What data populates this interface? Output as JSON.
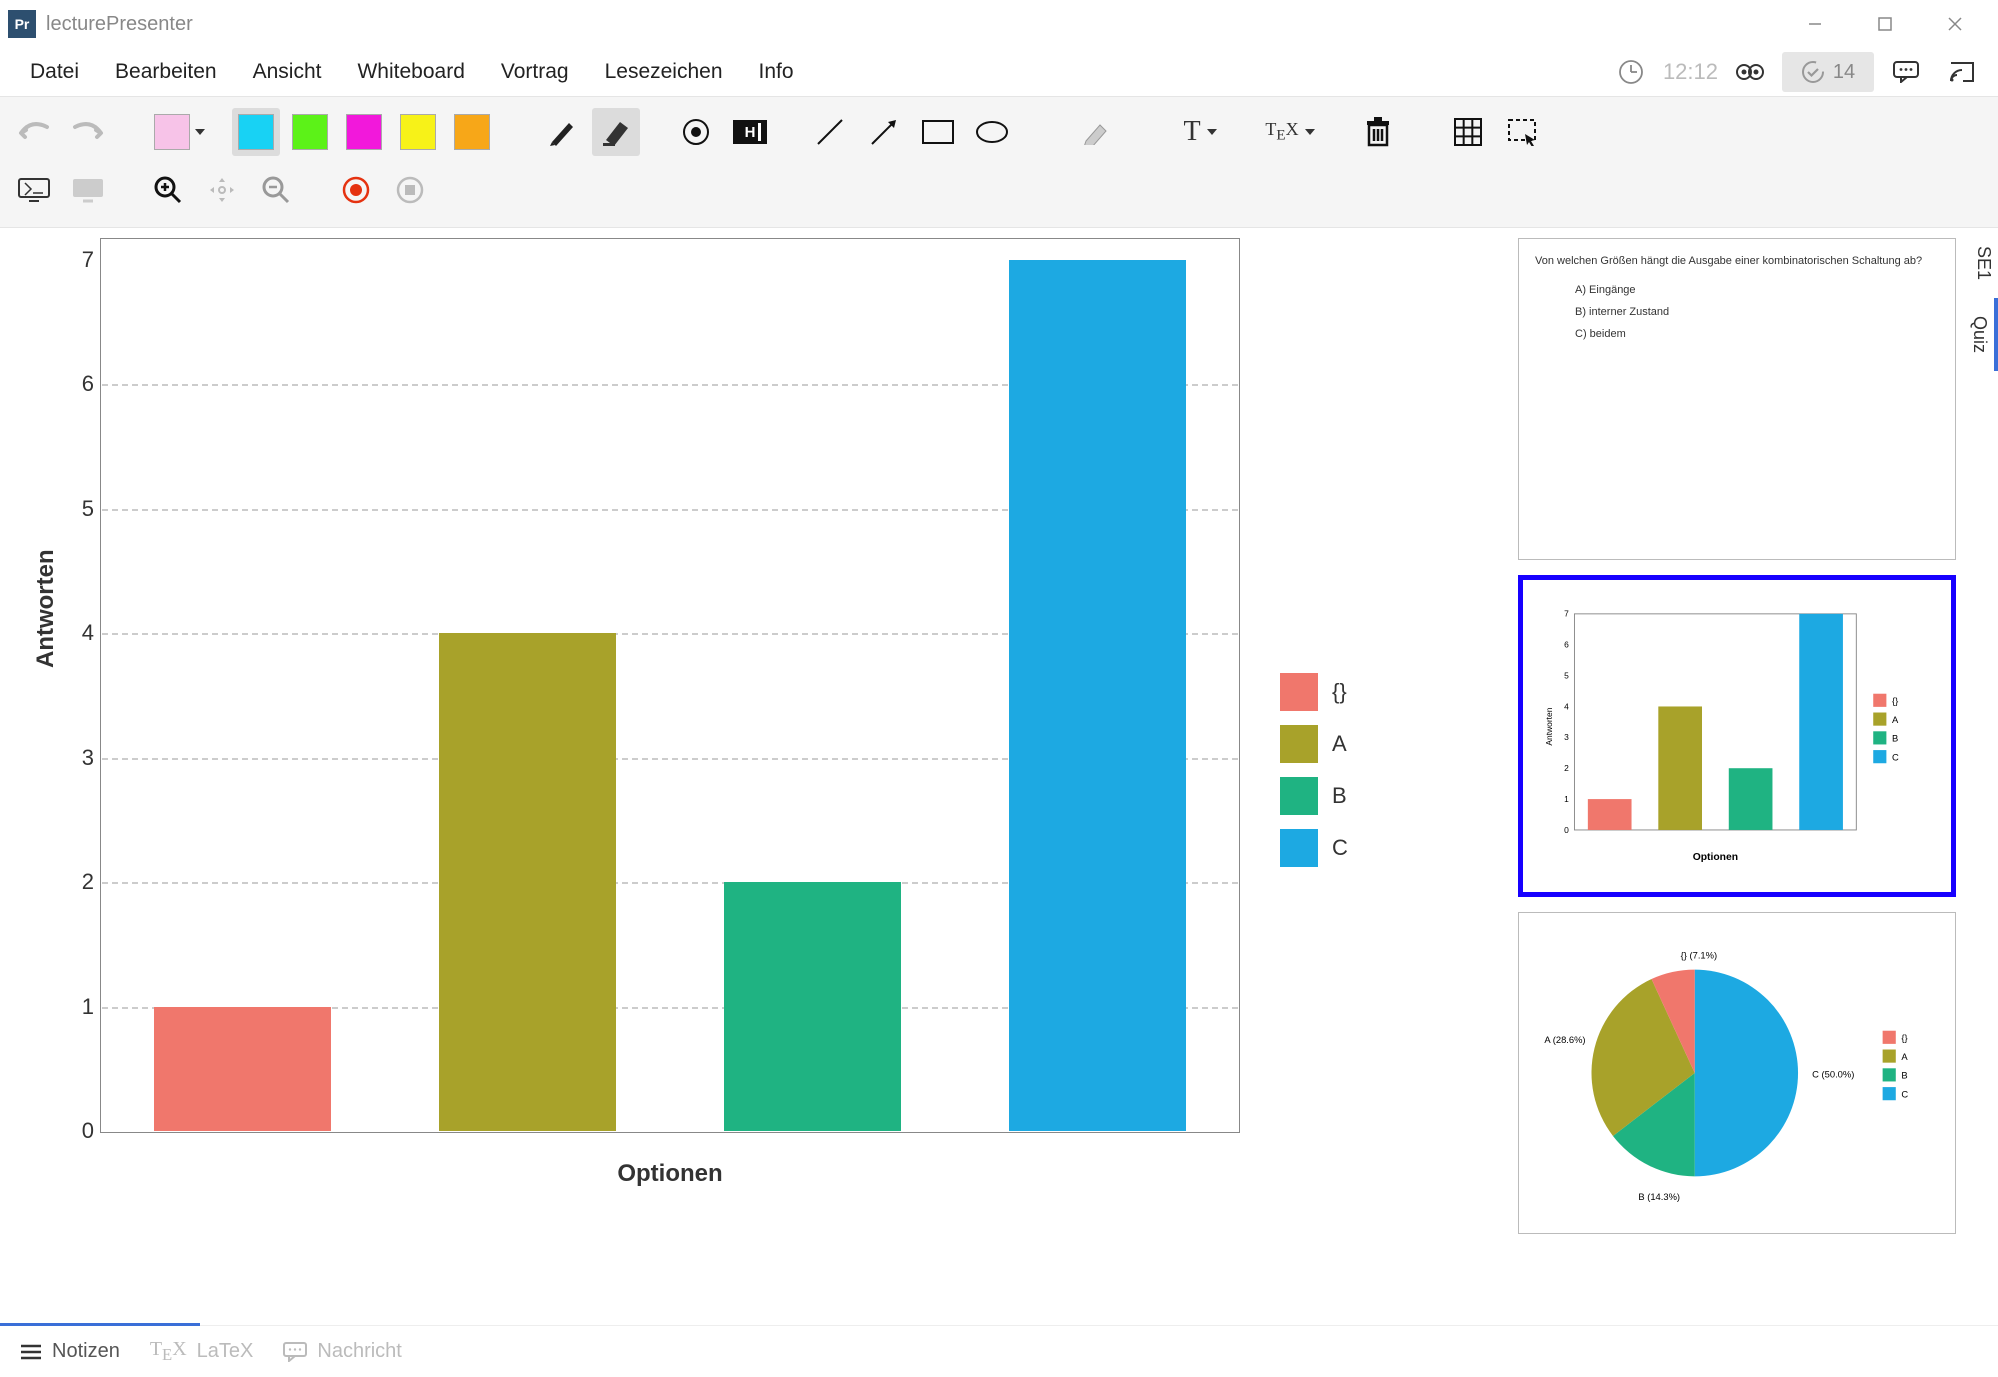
{
  "app": {
    "icon_text": "Pr",
    "title": "lecturePresenter"
  },
  "menu": [
    "Datei",
    "Bearbeiten",
    "Ansicht",
    "Whiteboard",
    "Vortrag",
    "Lesezeichen",
    "Info"
  ],
  "topbar": {
    "clock": "12:12",
    "counter": "14"
  },
  "palette": {
    "current": "#f7c3e8",
    "quick": [
      "#18d2f4",
      "#5cf218",
      "#f218db",
      "#f7f218",
      "#f7a718"
    ]
  },
  "chart_data": {
    "type": "bar",
    "categories": [
      "{}",
      "A",
      "B",
      "C"
    ],
    "values": [
      1,
      4,
      2,
      7
    ],
    "colors": [
      "#f0776c",
      "#a8a22a",
      "#1fb382",
      "#1da9e2"
    ],
    "xlabel": "Optionen",
    "ylabel": "Antworten",
    "ylim": [
      0,
      7
    ],
    "yticks": [
      0,
      1,
      2,
      3,
      4,
      5,
      6,
      7
    ],
    "legend": [
      {
        "label": "{}",
        "color": "#f0776c"
      },
      {
        "label": "A",
        "color": "#a8a22a"
      },
      {
        "label": "B",
        "color": "#1fb382"
      },
      {
        "label": "C",
        "color": "#1da9e2"
      }
    ]
  },
  "slides": {
    "question": {
      "prompt": "Von welchen Größen hängt die Ausgabe einer kombinatorischen Schaltung ab?",
      "options": [
        {
          "key": "A)",
          "text": "Eingänge"
        },
        {
          "key": "B)",
          "text": "interner Zustand"
        },
        {
          "key": "C)",
          "text": "beidem"
        }
      ]
    },
    "pie": {
      "labels": [
        {
          "text": "{} (7.1%)"
        },
        {
          "text": "A (28.6%)"
        },
        {
          "text": "B (14.3%)"
        },
        {
          "text": "C (50.0%)"
        }
      ]
    }
  },
  "side_tabs": [
    "SE1",
    "Quiz"
  ],
  "bottom_tabs": {
    "notes": "Notizen",
    "latex": "LaTeX",
    "message": "Nachricht"
  }
}
